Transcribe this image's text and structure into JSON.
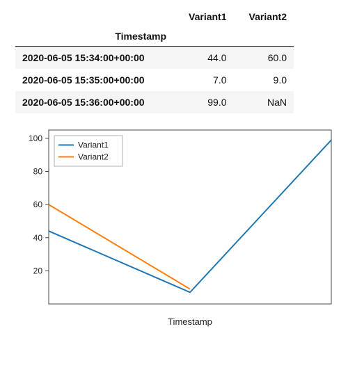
{
  "table": {
    "index_name": "Timestamp",
    "columns": [
      "Variant1",
      "Variant2"
    ],
    "rows": [
      {
        "ts": "2020-06-05 15:34:00+00:00",
        "cells": [
          "44.0",
          "60.0"
        ]
      },
      {
        "ts": "2020-06-05 15:35:00+00:00",
        "cells": [
          "7.0",
          "9.0"
        ]
      },
      {
        "ts": "2020-06-05 15:36:00+00:00",
        "cells": [
          "99.0",
          "NaN"
        ]
      }
    ]
  },
  "chart_data": {
    "type": "line",
    "title": "",
    "xlabel": "Timestamp",
    "ylabel": "",
    "ylim": [
      0,
      105
    ],
    "yticks": [
      20,
      40,
      60,
      80,
      100
    ],
    "x": [
      "2020-06-05 15:34:00+00:00",
      "2020-06-05 15:35:00+00:00",
      "2020-06-05 15:36:00+00:00"
    ],
    "series": [
      {
        "name": "Variant1",
        "values": [
          44.0,
          7.0,
          99.0
        ],
        "color": "#1f77b4"
      },
      {
        "name": "Variant2",
        "values": [
          60.0,
          9.0,
          null
        ],
        "color": "#ff7f0e"
      }
    ],
    "legend_position": "upper left"
  }
}
